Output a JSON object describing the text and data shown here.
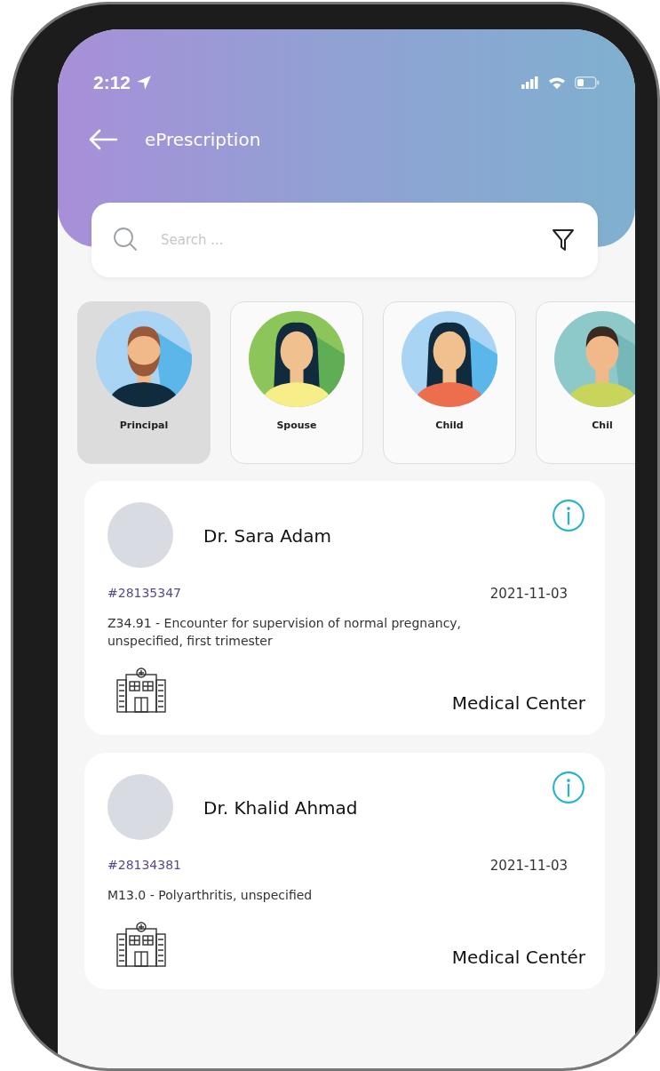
{
  "status_bar": {
    "time": "2:12"
  },
  "header": {
    "title": "ePrescription"
  },
  "search": {
    "placeholder": "Search ..."
  },
  "members": [
    {
      "label": "Principal",
      "selected": true,
      "kind": "man"
    },
    {
      "label": "Spouse",
      "selected": false,
      "kind": "woman"
    },
    {
      "label": "Child",
      "selected": false,
      "kind": "girl"
    },
    {
      "label": "Chil",
      "selected": false,
      "kind": "boy"
    }
  ],
  "prescriptions": [
    {
      "doctor": "Dr. Sara Adam",
      "number": "#28135347",
      "date": "2021-11-03",
      "diagnosis": "Z34.91 - Encounter for supervision of normal pregnancy, unspecified, first trimester",
      "facility": "Medical Center"
    },
    {
      "doctor": "Dr. Khalid Ahmad",
      "number": "#28134381",
      "date": "2021-11-03",
      "diagnosis": "M13.0 - Polyarthritis, unspecified",
      "facility": "Medical Centér"
    }
  ]
}
